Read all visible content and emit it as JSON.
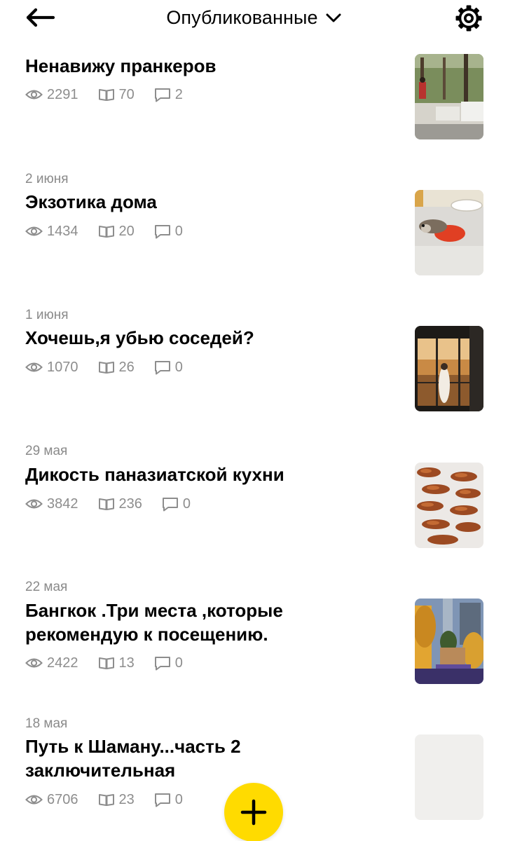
{
  "header": {
    "title": "Опубликованные"
  },
  "articles": [
    {
      "date": "",
      "title": "Ненавижу пранкеров",
      "views": "2291",
      "reads": "70",
      "comments": "2"
    },
    {
      "date": "2 июня",
      "title": "Экзотика дома",
      "views": "1434",
      "reads": "20",
      "comments": "0"
    },
    {
      "date": "1 июня",
      "title": "Хочешь,я убью соседей?",
      "views": "1070",
      "reads": "26",
      "comments": "0"
    },
    {
      "date": "29 мая",
      "title": "Дикость паназиатской кухни",
      "views": "3842",
      "reads": "236",
      "comments": "0"
    },
    {
      "date": "22 мая",
      "title": "Бангкок .Три места ,которые рекомендую к посещению.",
      "views": "2422",
      "reads": "13",
      "comments": "0"
    },
    {
      "date": "18 мая",
      "title": "Путь к Шаману...часть 2 заключительная",
      "views": "6706",
      "reads": "23",
      "comments": "0"
    }
  ],
  "icons": {
    "back": "arrow-left-icon",
    "dropdown": "chevron-down-icon",
    "settings": "gear-icon",
    "views": "eye-icon",
    "reads": "book-icon",
    "comments": "comment-icon",
    "add": "plus-icon"
  },
  "colors": {
    "accent": "#ffdb00",
    "meta_text": "#8d8d8d",
    "title_text": "#000000",
    "background": "#ffffff"
  }
}
